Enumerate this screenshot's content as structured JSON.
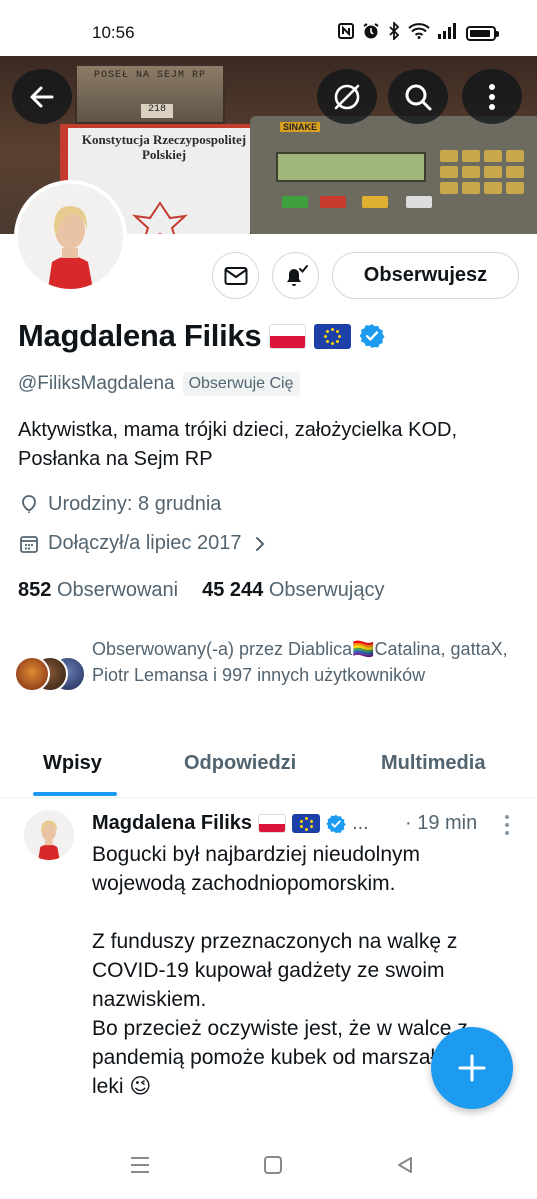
{
  "status_bar": {
    "time": "10:56"
  },
  "banner": {
    "plate_text": "POSEŁ NA SEJM RP",
    "plate_number": "218",
    "book_title": "Konstytucja Rzeczypospolitej Polskiej",
    "device_brand": "SINAKE"
  },
  "header": {
    "back_icon": "arrow-left-icon",
    "grok_icon": "slash-circle-icon",
    "search_icon": "search-icon",
    "more_icon": "more-vertical-icon"
  },
  "profile": {
    "name": "Magdalena Filiks",
    "handle": "@FiliksMagdalena",
    "follows_you": "Obserwuje Cię",
    "follow_button": "Obserwujesz",
    "bio": "Aktywistka, mama trójki dzieci, założycielka KOD, Posłanka na Sejm RP",
    "birthday": "Urodziny: 8 grudnia",
    "joined": "Dołączył/a lipiec 2017",
    "following_count": "852",
    "following_label": "Obserwowani",
    "followers_count": "45 244",
    "followers_label": "Obserwujący",
    "followed_by_text": "Obserwowany(-a) przez Diablica🏳️‍🌈Catalina, gattaX, Piotr Lemansa i 997 innych użytkowników"
  },
  "tabs": [
    "Wpisy",
    "Odpowiedzi",
    "Multimedia"
  ],
  "post": {
    "author": "Magdalena Filiks",
    "ellipsis": "...",
    "time": "· 19 min",
    "text": "Bogucki był najbardziej nieudolnym wojewodą zachodniopomorskim.\n\nZ funduszy przeznaczonych na walkę z COVID-19 kupował gadżety ze swoim nazwiskiem.\nBo przecież oczywiste jest, że w walce z pandemią pomoże kubek od marszałka, nie leki 😉"
  },
  "colors": {
    "accent": "#1d9bf0",
    "text_primary": "#0f1419",
    "text_secondary": "#536471",
    "border": "#cfd9de"
  }
}
